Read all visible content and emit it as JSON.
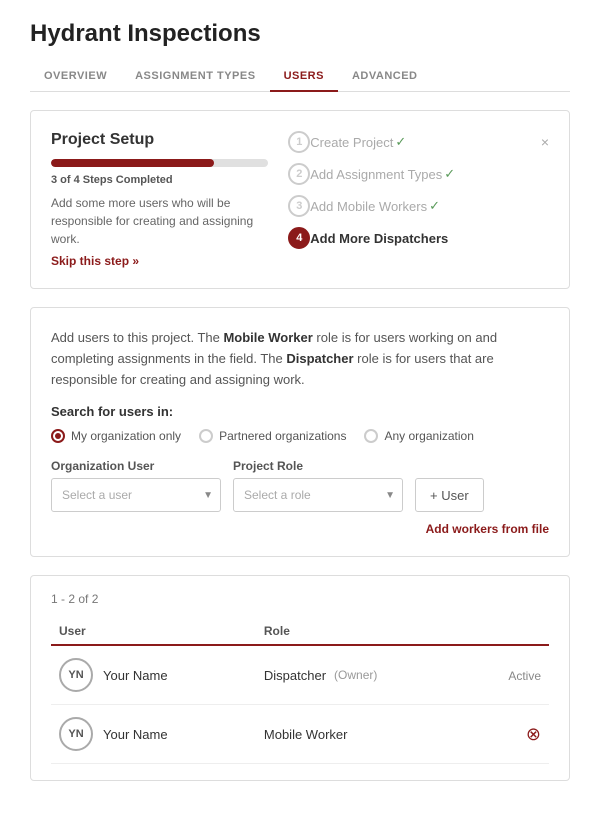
{
  "page": {
    "title": "Hydrant Inspections"
  },
  "nav": {
    "tabs": [
      {
        "id": "overview",
        "label": "OVERVIEW",
        "active": false
      },
      {
        "id": "assignment-types",
        "label": "ASSIGNMENT TYPES",
        "active": false
      },
      {
        "id": "users",
        "label": "USERS",
        "active": true
      },
      {
        "id": "advanced",
        "label": "ADVANCED",
        "active": false
      }
    ]
  },
  "project_setup": {
    "title": "Project Setup",
    "progress_percent": 75,
    "steps_completed": "3 of 4 Steps Completed",
    "description": "Add some more users who will be responsible for creating and assigning work.",
    "skip_label": "Skip this step",
    "close_label": "×",
    "steps": [
      {
        "num": "1",
        "label": "Create Project",
        "completed": true,
        "active": false
      },
      {
        "num": "2",
        "label": "Add Assignment Types",
        "completed": true,
        "active": false
      },
      {
        "num": "3",
        "label": "Add Mobile Workers",
        "completed": true,
        "active": false
      },
      {
        "num": "4",
        "label": "Add More Dispatchers",
        "completed": false,
        "active": true
      }
    ]
  },
  "users_section": {
    "description_part1": "Add users to this project. The ",
    "mobile_worker_bold": "Mobile Worker",
    "description_part2": " role is for users working on and completing assignments in the field. The ",
    "dispatcher_bold": "Dispatcher",
    "description_part3": " role is for users that are responsible for creating and assigning work.",
    "search_label": "Search for users in:",
    "radio_options": [
      {
        "id": "my-org",
        "label": "My organization only",
        "selected": true
      },
      {
        "id": "partnered",
        "label": "Partnered organizations",
        "selected": false
      },
      {
        "id": "any",
        "label": "Any organization",
        "selected": false
      }
    ],
    "user_field_label": "Organization User",
    "user_placeholder": "Select a user",
    "role_field_label": "Project Role",
    "role_placeholder": "Select a role",
    "add_user_btn": "+ User",
    "add_from_file": "Add workers from file"
  },
  "users_table": {
    "count_label": "1 - 2 of 2",
    "columns": [
      "User",
      "Role"
    ],
    "rows": [
      {
        "initials": "YN",
        "name": "Your Name",
        "role": "Dispatcher",
        "role_suffix": "(Owner)",
        "status": "Active",
        "removable": false
      },
      {
        "initials": "YN",
        "name": "Your Name",
        "role": "Mobile Worker",
        "role_suffix": "",
        "status": "",
        "removable": true
      }
    ]
  }
}
